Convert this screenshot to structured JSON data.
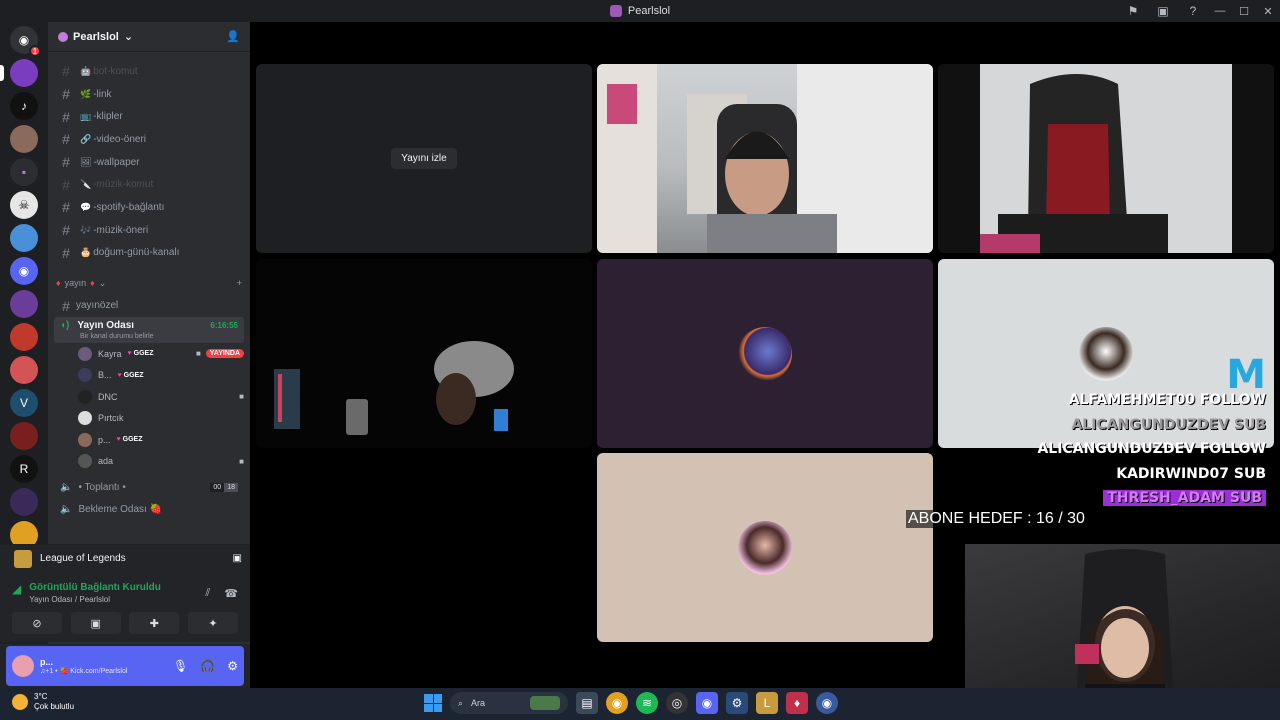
{
  "window": {
    "title": "Pearlslol"
  },
  "guild": {
    "name": "Pearlslol"
  },
  "channels": [
    {
      "name": "bot-komut",
      "emoji": "🤖",
      "muted": true
    },
    {
      "name": "-link",
      "emoji": "🌿",
      "muted": false
    },
    {
      "name": "-klipler",
      "emoji": "📺",
      "muted": false
    },
    {
      "name": "-video-öneri",
      "emoji": "🔗",
      "muted": false
    },
    {
      "name": "-wallpaper",
      "emoji": "🖼",
      "muted": false
    },
    {
      "name": "-müzik-komut",
      "emoji": "🔪",
      "muted": true
    },
    {
      "name": "-spotify-bağlantı",
      "emoji": "💬",
      "muted": false
    },
    {
      "name": "-müzik-öneri",
      "emoji": "🎶",
      "muted": false
    },
    {
      "name": "doğum-günü-kanalı",
      "emoji": "🎂",
      "muted": false
    }
  ],
  "category": {
    "name": "yayın",
    "add_icon": "+"
  },
  "text_channel_yayinozel": "yayınözel",
  "voice_active": {
    "name": "Yayın Odası",
    "time": "6:16:55",
    "status": "Bir kanal durumu belirle"
  },
  "members": [
    {
      "name": "Kayra",
      "tag": "GGEZ",
      "live": "YAYINDA",
      "cam": true
    },
    {
      "name": "B...",
      "tag": "GGEZ",
      "live": "",
      "cam": false
    },
    {
      "name": "DNC",
      "tag": "",
      "live": "",
      "cam": true
    },
    {
      "name": "Pırtcık",
      "tag": "",
      "live": "",
      "cam": false
    },
    {
      "name": "p...",
      "tag": "GGEZ",
      "live": "",
      "cam": false
    },
    {
      "name": "ada",
      "tag": "",
      "live": "",
      "cam": true
    }
  ],
  "voice_channels": [
    {
      "name": "• Toplantı •",
      "count_a": "00",
      "count_b": "18"
    },
    {
      "name": "Bekleme Odası 🍓",
      "count_a": "",
      "count_b": ""
    }
  ],
  "activity": {
    "name": "League of Legends"
  },
  "rtc": {
    "title": "Görüntülü Bağlantı Kuruldu",
    "channel": "Yayın Odası",
    "guild": "/ Pearlslol"
  },
  "user": {
    "name": "p...",
    "status": "♫+1 • 🍓 Kick.com/Pearlslol"
  },
  "stage": {
    "watch_label": "Yayını izle"
  },
  "overlay": {
    "feed": [
      {
        "text": "ALFAMEHMET00  FOLLOW",
        "style": "normal"
      },
      {
        "text": "ALICANGUNDUZDEV  SUB",
        "style": "faded"
      },
      {
        "text": "ALICANGUNDUZDEV  FOLLOW",
        "style": "normal"
      },
      {
        "text": "KADIRWIND07  SUB",
        "style": "normal"
      },
      {
        "text": "THRESH_ADAM  SUB",
        "style": "hl"
      }
    ],
    "abone": "ABONE HEDEF : 16 / 30",
    "logo": "M"
  },
  "taskbar": {
    "temp": "3°C",
    "weather": "Çok bulutlu",
    "search_placeholder": "Ara"
  },
  "colors": {
    "accent": "#5865f2",
    "live": "#f23f43",
    "connected": "#23a55a"
  }
}
